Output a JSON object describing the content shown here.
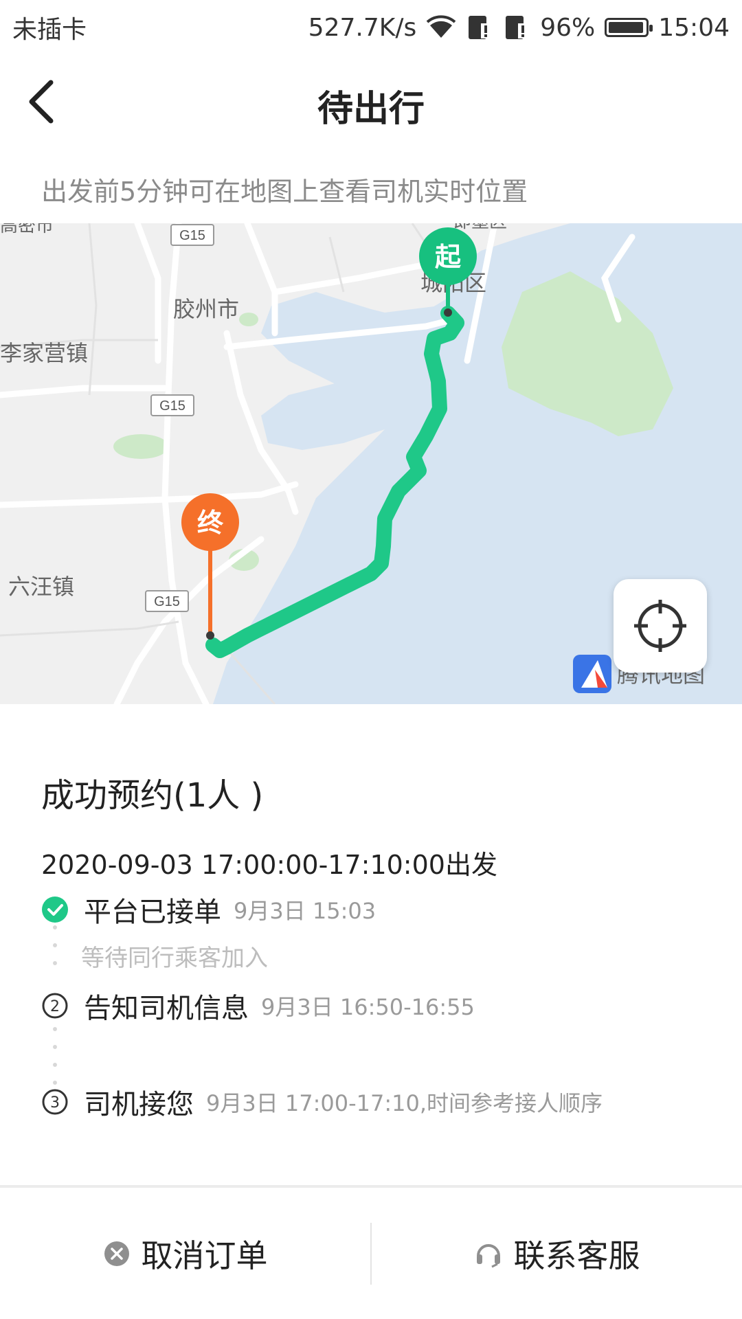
{
  "status": {
    "carrier": "未插卡",
    "speed": "527.7K/s",
    "battery": "96%",
    "battery_level": 0.96,
    "time": "15:04"
  },
  "header": {
    "title": "待出行",
    "back_icon": "chevron-left-icon"
  },
  "hint": "出发前5分钟可在地图上查看司机实时位置",
  "map": {
    "labels": {
      "jiaozhou": "胶州市",
      "lijiaying": "李家营镇",
      "liuwang": "六汪镇",
      "chengyang": "城阳区",
      "g15_a": "G15",
      "g15_b": "G15",
      "g15_c": "G15",
      "top_left": "高密市",
      "top_center": "即墨区"
    },
    "start_marker": "起",
    "end_marker": "终",
    "provider": "腾讯地图",
    "route_color": "#1fc888",
    "start_color": "#17c07f",
    "end_color": "#f5702a",
    "water_color": "#d6e4f2",
    "green_color": "#cde9c8"
  },
  "booking": {
    "title": "成功预约(1人 )",
    "depart_time": "2020-09-03 17:00:00-17:10:00出发",
    "steps": [
      {
        "label": "平台已接单",
        "time": "9月3日 15:03",
        "icon": "check-circle-icon"
      },
      {
        "label": "告知司机信息",
        "time": "9月3日 16:50-16:55",
        "number": "2"
      },
      {
        "label": "司机接您",
        "time": "9月3日 17:00-17:10,时间参考接人顺序",
        "number": "3"
      }
    ],
    "sub_note": "等待同行乘客加入"
  },
  "actions": {
    "cancel": "取消订单",
    "contact": "联系客服"
  }
}
